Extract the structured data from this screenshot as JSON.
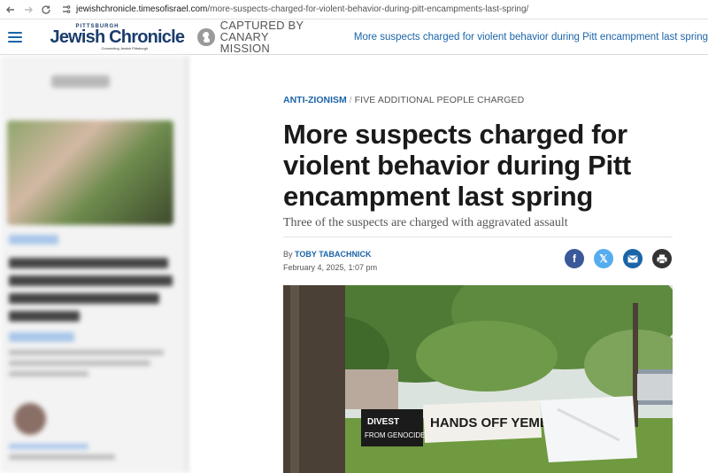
{
  "browser": {
    "url_host": "jewishchronicle.timesofisrael.com",
    "url_path": "/more-suspects-charged-for-violent-behavior-during-pitt-encampments-last-spring/"
  },
  "header": {
    "logo_top": "PITTSBURGH",
    "logo_main": "Jewish Chronicle",
    "logo_sub": "Connecting Jewish Pittsburgh",
    "badge_line1": "CAPTURED BY",
    "badge_line2": "CANARY MISSION",
    "headline": "More suspects charged for violent behavior during Pitt encampment last spring"
  },
  "article": {
    "category": "ANTI-ZIONISM",
    "subcategory": "FIVE ADDITIONAL PEOPLE CHARGED",
    "title": "More suspects charged for violent behavior during Pitt encampment last spring",
    "subtitle": "Three of the suspects are charged with aggravated assault",
    "by_prefix": "By",
    "author": "TOBY TABACHNICK",
    "date": "February 4, 2025, 1:07 pm"
  },
  "share": {
    "facebook": "f",
    "x": "𝕏"
  },
  "photo": {
    "banner1_line1": "DIVEST",
    "banner1_line2": "FROM GENOCIDE",
    "banner2": "HANDS OFF YEMEN"
  },
  "colors": {
    "accent": "#1b64a8",
    "facebook": "#3b5998",
    "twitter": "#55acee",
    "print": "#333333"
  },
  "icons": [
    "back-arrow-icon",
    "forward-arrow-icon",
    "reload-icon",
    "site-info-icon",
    "hamburger-icon",
    "canary-bird-icon",
    "facebook-icon",
    "x-icon",
    "mail-icon",
    "print-icon"
  ]
}
